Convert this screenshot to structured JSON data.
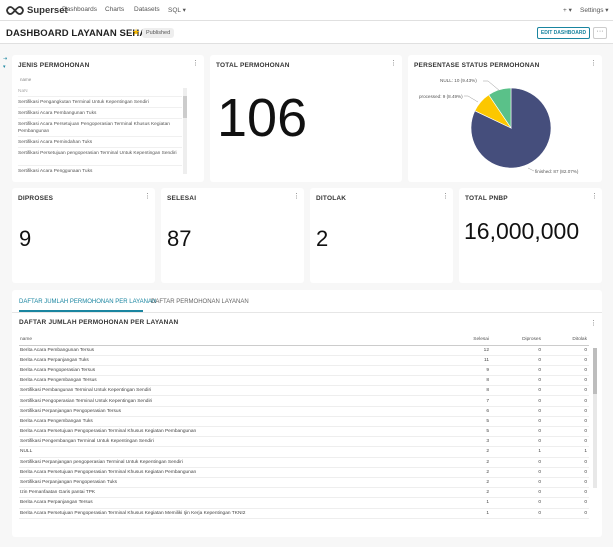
{
  "nav": {
    "brand": "Superset",
    "links": [
      "Dashboards",
      "Charts",
      "Datasets",
      "SQL ▾"
    ],
    "plus": "+ ▾",
    "settings": "Settings ▾"
  },
  "header": {
    "title": "DASHBOARD LAYANAN SEHATI",
    "badge": "Published",
    "edit_label": "EDIT DASHBOARD",
    "more_label": "···"
  },
  "cards": {
    "jenis": {
      "title": "JENIS PERMOHONAN",
      "search_hint": "name",
      "items": [
        "NaN",
        "Sertifikasi Pengangkutan Terminal Untuk Kepentingan Sendiri",
        "Sertifikasi Acara Pembangunan Tuks",
        "Sertifikasi Acara Persetujuan Pengoperasian Terminal Khusus Kegiatan Pembangunan",
        "Sertifikasi Acara Pemindahan Tuks",
        "Sertifikasi Persetujuan pengoperasian Terminal Untuk Kepentingan Sendiri",
        "Sertifikasi Acara Penggunaan Tuks"
      ]
    },
    "total": {
      "title": "TOTAL PERMOHONAN",
      "value": "106"
    },
    "status": {
      "title": "PERSENTASE STATUS PERMOHONAN"
    },
    "diproses": {
      "title": "DIPROSES",
      "value": "9"
    },
    "selesai": {
      "title": "SELESAI",
      "value": "87"
    },
    "ditolak": {
      "title": "DITOLAK",
      "value": "2"
    },
    "pnbp": {
      "title": "TOTAL PNBP",
      "value": "16,000,000"
    }
  },
  "chart_data": {
    "type": "pie",
    "slices": [
      {
        "name": "finished",
        "value": 87,
        "label": "finished: 87 (82.07%)",
        "color": "#454e7c"
      },
      {
        "name": "NULL",
        "value": 10,
        "label": "NULL: 10 (9.43%)",
        "color": "#5ac189"
      },
      {
        "name": "processed",
        "value": 9,
        "label": "processed: 9 (8.49%)",
        "color": "#fcc700"
      }
    ]
  },
  "tabs": {
    "items": [
      "DAFTAR JUMLAH PERMOHONAN PER LAYANAN",
      "DAFTAR PERMOHONAN LAYANAN"
    ],
    "table_title": "DAFTAR JUMLAH PERMOHONAN PER LAYANAN"
  },
  "table": {
    "headers": [
      "name",
      "Selesai",
      "Diproses",
      "Ditolak"
    ],
    "rows": [
      [
        "Berita Acara Pembangunan Tersus",
        "12",
        "0",
        "0"
      ],
      [
        "Berita Acara Perpanjangan Tuks",
        "11",
        "0",
        "0"
      ],
      [
        "Berita Acara Pengoperasian Tersus",
        "9",
        "0",
        "0"
      ],
      [
        "Berita Acara Pengembangan Tersus",
        "8",
        "0",
        "0"
      ],
      [
        "Sertifikasi Pembangunan Terminal Untuk Kepentingan Sendiri",
        "8",
        "0",
        "0"
      ],
      [
        "Sertifikasi Pengoperasian Terminal Untuk Kepentingan Sendiri",
        "7",
        "0",
        "0"
      ],
      [
        "Sertifikasi Perpanjangan Pengoperasian Tersus",
        "6",
        "0",
        "0"
      ],
      [
        "Berita Acara Pengembangan Tuks",
        "5",
        "0",
        "0"
      ],
      [
        "Berita Acara Persetujuan Pengoperasian Terminal Khusus Kegiatan Pembangunan",
        "5",
        "0",
        "0"
      ],
      [
        "Sertifikasi Pengembangan Terminal Untuk Kepentingan Sendiri",
        "3",
        "0",
        "0"
      ],
      [
        "NULL",
        "2",
        "1",
        "1"
      ],
      [
        "Sertifikasi Perpanjangan pengoperasian Terminal Untuk Kepentingan Sendiri",
        "2",
        "0",
        "0"
      ],
      [
        "Berita Acara Persetujuan Pengoperasian Terminal Khusus Kegiatan Pembangunan",
        "2",
        "0",
        "0"
      ],
      [
        "Sertifikasi Perpanjangan Pengoperasian Tuks",
        "2",
        "0",
        "0"
      ],
      [
        "Izin Pemanfaatan Garis pantai TPK",
        "2",
        "0",
        "0"
      ],
      [
        "Berita Acara Perpanjangan Tersus",
        "1",
        "0",
        "0"
      ],
      [
        "Berita Acara Persetujuan Pengoperasian Terminal Khusus Kegiatan Memiliki Ijin Kerja Kepentingan TKNI2",
        "1",
        "0",
        "0"
      ]
    ]
  }
}
